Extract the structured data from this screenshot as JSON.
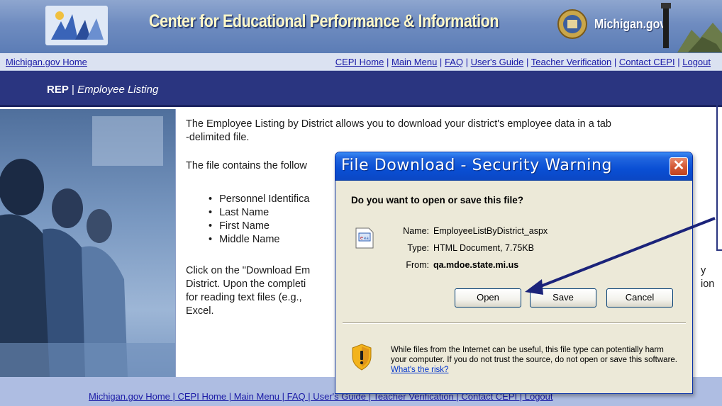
{
  "banner": {
    "title": "Center for Educational Performance & Information",
    "michigan_logo": "Michigan.gov"
  },
  "navbar": {
    "home_link": "Michigan.gov Home",
    "links": [
      "CEPI Home",
      "Main Menu",
      "FAQ",
      "User's Guide",
      "Teacher Verification",
      "Contact CEPI",
      "Logout"
    ],
    "separator": "|"
  },
  "section": {
    "app": "REP",
    "separator": "|",
    "page": "Employee Listing"
  },
  "content": {
    "intro_line1": "The Employee Listing by District allows you to download your district's employee data in a tab",
    "intro_line2": "-delimited file.",
    "contains_label": "The file contains the follow",
    "fields": [
      "Personnel Identifica",
      "Last Name",
      "First Name",
      "Middle Name"
    ],
    "download_line1": "Click on the \"Download Em",
    "download_line1_end": "y",
    "download_line2": "District. Upon the completi",
    "download_line2_end": "ion",
    "download_line3": "for reading text files (e.g.,",
    "download_line4": "Excel."
  },
  "footer": {
    "links_visible": "Michigan.gov Home | CEPI Home | Main Menu | FAQ | User's Guide | Teacher Verification | Contact CEPI | Logout"
  },
  "dialog": {
    "title": "File Download - Security Warning",
    "close_glyph": "✕",
    "question": "Do you want to open or save this file?",
    "name_label": "Name:",
    "name_value": "EmployeeListByDistrict_aspx",
    "type_label": "Type:",
    "type_value": "HTML Document, 7.75KB",
    "from_label": "From:",
    "from_value": "qa.mdoe.state.mi.us",
    "open_button": "Open",
    "save_button": "Save",
    "cancel_button": "Cancel",
    "warning_text": "While files from the Internet can be useful, this file type can potentially harm your computer. If you do not trust the source, do not open or save this software.",
    "risk_link": "What's the risk?"
  },
  "colors": {
    "banner": "#6f8cc0",
    "section_bar": "#2a3580",
    "footer": "#aebde2",
    "dialog_title": "#0a4fd4",
    "link": "#1a1aa6"
  },
  "icons": [
    "cepi-logo-icon",
    "michigan-seal-icon",
    "lighthouse-icon",
    "html-file-icon",
    "shield-warning-icon",
    "close-icon"
  ]
}
